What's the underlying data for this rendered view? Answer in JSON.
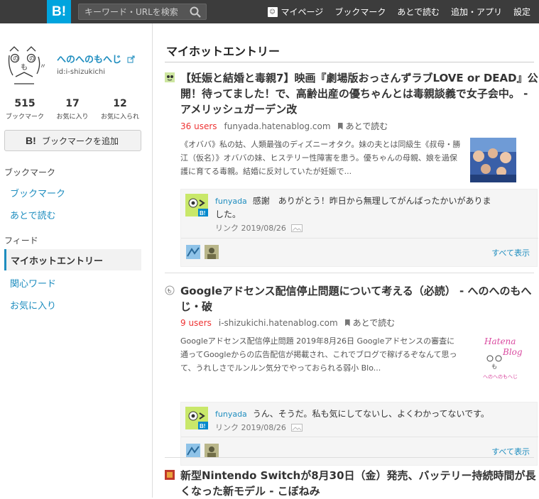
{
  "header": {
    "logo": "B!",
    "search_placeholder": "キーワード・URLを検索",
    "nav": [
      "マイページ",
      "ブックマーク",
      "あとで読む",
      "追加・アプリ",
      "設定"
    ]
  },
  "sidebar": {
    "profile": {
      "name": "へのへのもへじ",
      "id": "id:i-shizukichi"
    },
    "stats": [
      {
        "num": "515",
        "label": "ブックマーク"
      },
      {
        "num": "17",
        "label": "お気に入り"
      },
      {
        "num": "12",
        "label": "お気に入られ"
      }
    ],
    "add_bookmark": {
      "b": "B!",
      "label": "ブックマークを追加"
    },
    "section_bookmark": "ブックマーク",
    "links_bookmark": [
      "ブックマーク",
      "あとで読む"
    ],
    "section_feed": "フィード",
    "feed_active": "マイホットエントリー",
    "links_feed": [
      "関心ワード",
      "お気に入り"
    ]
  },
  "main": {
    "title": "マイホットエントリー",
    "entries": [
      {
        "title": "【妊娠と結婚と毒親7】映画『劇場版おっさんずラブLOVE or DEAD』公開！待ってました！で、高齢出産の優ちゃんとは毒親談義で女子会中。 - アメリッシュガーデン改",
        "users": "36 users",
        "domain": "funyada.hatenablog.com",
        "later": "あとで読む",
        "desc": "《オババ》私の姑、人類最強のディズニーオタク。妹の夫とは同級生《叔母・勝江（仮名）》オババの妹、ヒステリー性障害を患う。優ちゃんの母親、娘を過保護に育てる毒親。結婚に反対していたが妊娠で...",
        "comment": {
          "user": "funyada",
          "text": "感謝　ありがとう！昨日から無理してがんばったかいがありました。",
          "meta": "リンク 2019/08/26"
        },
        "show_all": "すべて表示"
      },
      {
        "title": "Googleアドセンス配信停止問題について考える（必読） - へのへのもへじ・破",
        "users": "9 users",
        "domain": "i-shizukichi.hatenablog.com",
        "later": "あとで読む",
        "desc": "Googleアドセンス配信停止問題 2019年8月26日 Googleアドセンスの審査に通ってGoogleからの広告配信が掲載され、これでブログで稼げるぞなんて思って、うれしさでルンルン気分でやっておられる弱小 Blo...",
        "thumb_text": [
          "Hatena",
          "Blog",
          "へのへのもへじ"
        ],
        "comment": {
          "user": "funyada",
          "text": "うん、そうだ。私も気にしてないし、よくわかってないです。",
          "meta": "リンク 2019/08/26"
        },
        "show_all": "すべて表示"
      },
      {
        "title": "新型Nintendo Switchが8月30日（金）発売、バッテリー持続時間が長くなった新モデル - こぼねみ"
      }
    ]
  },
  "colors": {
    "accent": "#00a4de",
    "link": "#1e8dbf",
    "users": "#ee3333",
    "header": "#3c3c3c"
  }
}
